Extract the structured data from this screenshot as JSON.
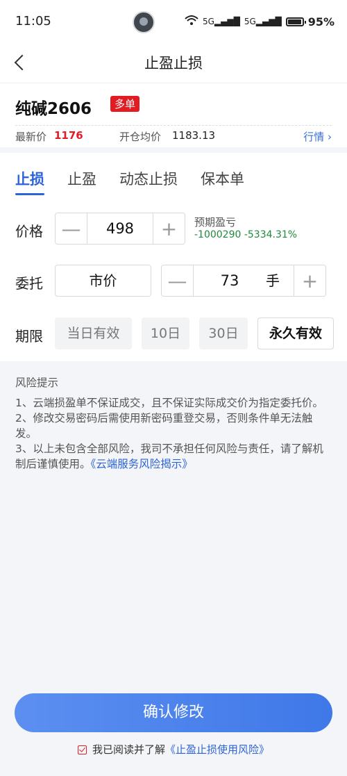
{
  "status_bar": {
    "time": "11:05",
    "battery": "95%",
    "signal1": "5G",
    "signal2": "5G"
  },
  "header": {
    "title": "止盈止损"
  },
  "product": {
    "name": "纯碱2606",
    "tag": "多单",
    "last_price_label": "最新价",
    "last_price": "1176",
    "open_avg_label": "开仓均价",
    "open_avg": "1183.13",
    "quote_link": "行情 ›"
  },
  "tabs": [
    {
      "label": "止损",
      "active": true
    },
    {
      "label": "止盈",
      "active": false
    },
    {
      "label": "动态止损",
      "active": false
    },
    {
      "label": "保本单",
      "active": false
    }
  ],
  "form": {
    "price_label": "价格",
    "price_value": "498",
    "expected_pnl_label": "预期盈亏",
    "expected_pnl_value": "-1000290 -5334.31%",
    "order_label": "委托",
    "order_type": "市价",
    "quantity": "73",
    "quantity_unit": "手",
    "validity_label": "期限",
    "validity_options": [
      {
        "label": "当日有效",
        "selected": false
      },
      {
        "label": "10日",
        "selected": false
      },
      {
        "label": "30日",
        "selected": false
      },
      {
        "label": "永久有效",
        "selected": true
      }
    ]
  },
  "risk": {
    "title": "风险提示",
    "items": [
      "1、云端损盈单不保证成交，且不保证实际成交价为指定委托价。",
      "2、修改交易密码后需使用新密码重登交易，否则条件单无法触发。",
      "3、以上未包含全部风险，我司不承担任何风险与责任，请了解机制后谨慎使用。"
    ],
    "link": "《云端服务风险揭示》"
  },
  "confirm_button": "确认修改",
  "agreement": {
    "text": "我已阅读并了解",
    "link": "《止盈止损使用风险》"
  },
  "colors": {
    "accent": "#2b63d8",
    "red": "#e31c23",
    "green": "#1e8a3a"
  }
}
